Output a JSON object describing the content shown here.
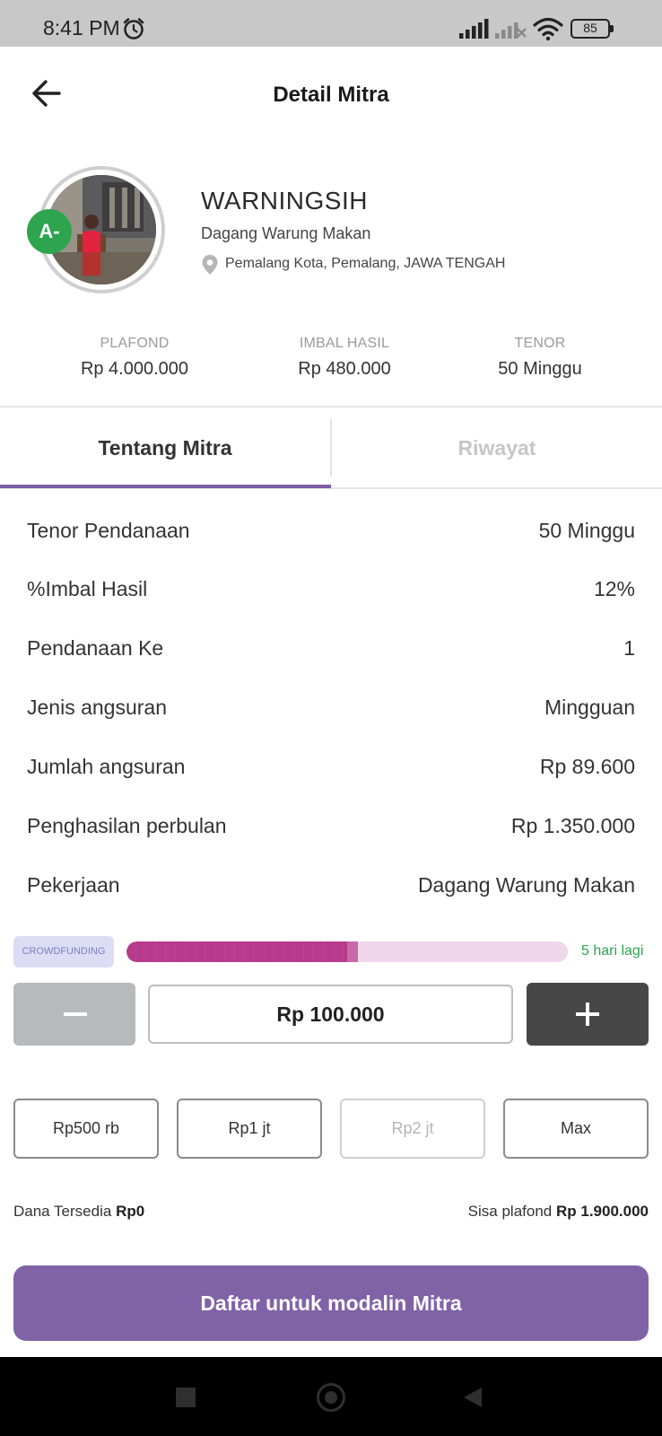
{
  "status_bar": {
    "time": "8:41 PM",
    "battery": "85"
  },
  "header": {
    "title": "Detail Mitra"
  },
  "profile": {
    "grade": "A-",
    "name": "WARNINGSIH",
    "job": "Dagang Warung Makan",
    "location": "Pemalang Kota, Pemalang, JAWA TENGAH"
  },
  "summary": [
    {
      "label": "PLAFOND",
      "value": "Rp 4.000.000"
    },
    {
      "label": "IMBAL HASIL",
      "value": "Rp 480.000"
    },
    {
      "label": "TENOR",
      "value": "50 Minggu"
    }
  ],
  "tabs": [
    {
      "label": "Tentang Mitra",
      "active": true
    },
    {
      "label": "Riwayat",
      "active": false
    }
  ],
  "details": [
    {
      "label": "Tenor Pendanaan",
      "value": "50 Minggu"
    },
    {
      "label": "%Imbal Hasil",
      "value": "12%"
    },
    {
      "label": "Pendanaan Ke",
      "value": "1"
    },
    {
      "label": "Jenis angsuran",
      "value": "Mingguan"
    },
    {
      "label": "Jumlah angsuran",
      "value": "Rp 89.600"
    },
    {
      "label": "Penghasilan perbulan",
      "value": "Rp 1.350.000"
    },
    {
      "label": "Pekerjaan",
      "value": "Dagang Warung Makan"
    }
  ],
  "crowdfunding": {
    "badge": "CROWDFUNDING",
    "progress_fraction": 0.525,
    "days_left": "5 hari lagi"
  },
  "stepper": {
    "amount": "Rp 100.000"
  },
  "quick_amounts": [
    {
      "label": "Rp500 rb",
      "enabled": true
    },
    {
      "label": "Rp1 jt",
      "enabled": true
    },
    {
      "label": "Rp2 jt",
      "enabled": false
    },
    {
      "label": "Max",
      "enabled": true
    }
  ],
  "funds": {
    "available_label": "Dana Tersedia",
    "available_value": "Rp0",
    "remaining_label": "Sisa plafond",
    "remaining_value": "Rp 1.900.000"
  },
  "cta": {
    "label": "Daftar untuk modalin Mitra"
  },
  "colors": {
    "accent": "#7e5da6",
    "cta": "#8062a6",
    "progress": "#b73a8c",
    "progress_track": "#efd6ea",
    "grade": "#2ea44f",
    "days_left": "#2ea44f"
  },
  "icons": {
    "back": "arrow-left-icon",
    "alarm": "alarm-clock-icon",
    "location": "map-pin-icon",
    "minus": "minus-icon",
    "plus": "plus-icon"
  }
}
